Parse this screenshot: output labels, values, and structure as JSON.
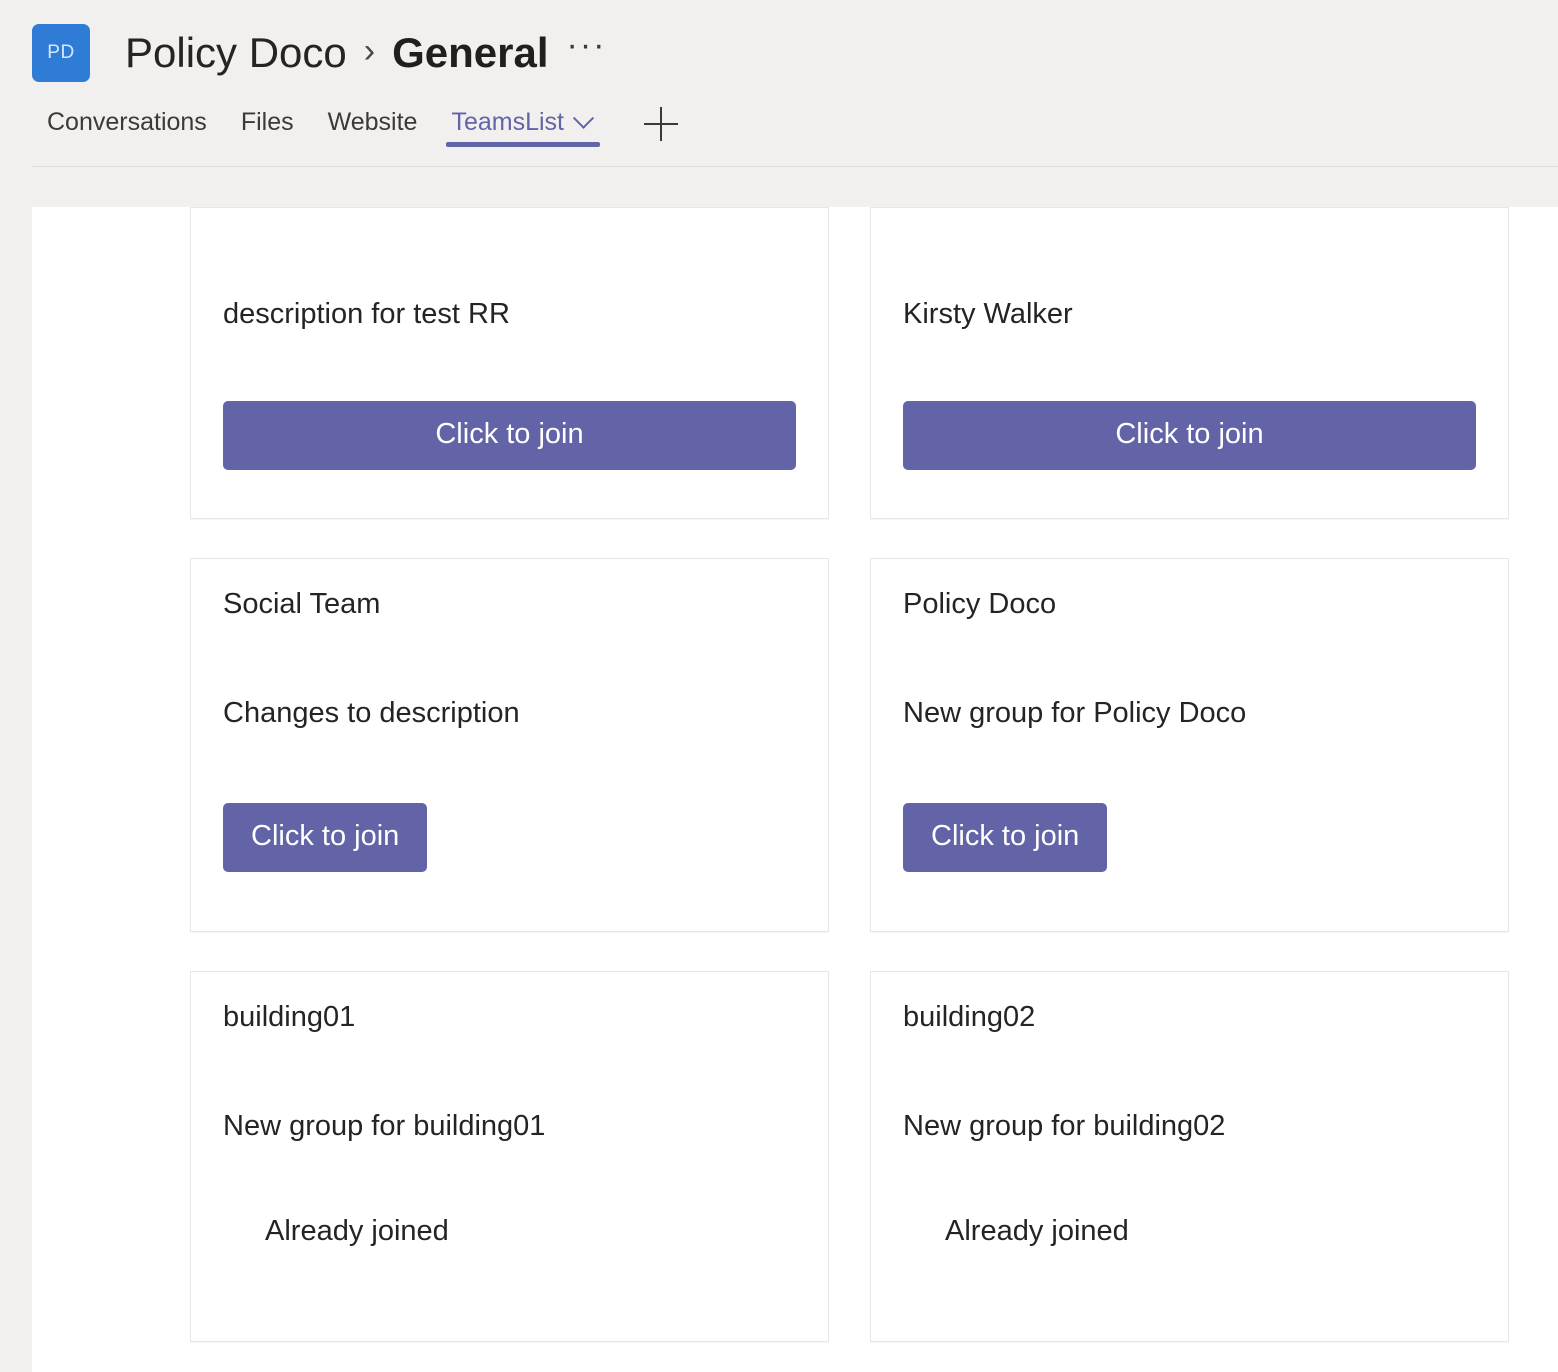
{
  "header": {
    "avatar_initials": "PD",
    "team_name": "Policy Doco",
    "separator": "›",
    "channel_name": "General",
    "overflow": "···"
  },
  "tabs": {
    "items": [
      {
        "label": "Conversations",
        "active": false
      },
      {
        "label": "Files",
        "active": false
      },
      {
        "label": "Website",
        "active": false
      },
      {
        "label": "TeamsList",
        "active": true
      }
    ],
    "add_tab_label": "+"
  },
  "colors": {
    "accent_purple": "#6264a7",
    "avatar_blue": "#2f7cd6",
    "page_background": "#f1f0ef",
    "card_border": "#e6e6e6"
  },
  "teams_list": {
    "join_button_label": "Click to join",
    "already_joined_label": "Already joined",
    "cards": [
      {
        "title": "",
        "description": "description for test RR",
        "action": "join",
        "clipped_top": true
      },
      {
        "title": "",
        "description": "Kirsty Walker",
        "action": "join",
        "clipped_top": true
      },
      {
        "title": "Social Team",
        "description": "Changes to description",
        "action": "join",
        "clipped_top": false
      },
      {
        "title": "Policy Doco",
        "description": "New group for Policy Doco",
        "action": "join",
        "clipped_top": false
      },
      {
        "title": "building01",
        "description": "New group for building01",
        "action": "joined",
        "clipped_top": false
      },
      {
        "title": "building02",
        "description": "New group for building02",
        "action": "joined",
        "clipped_top": false
      }
    ]
  }
}
